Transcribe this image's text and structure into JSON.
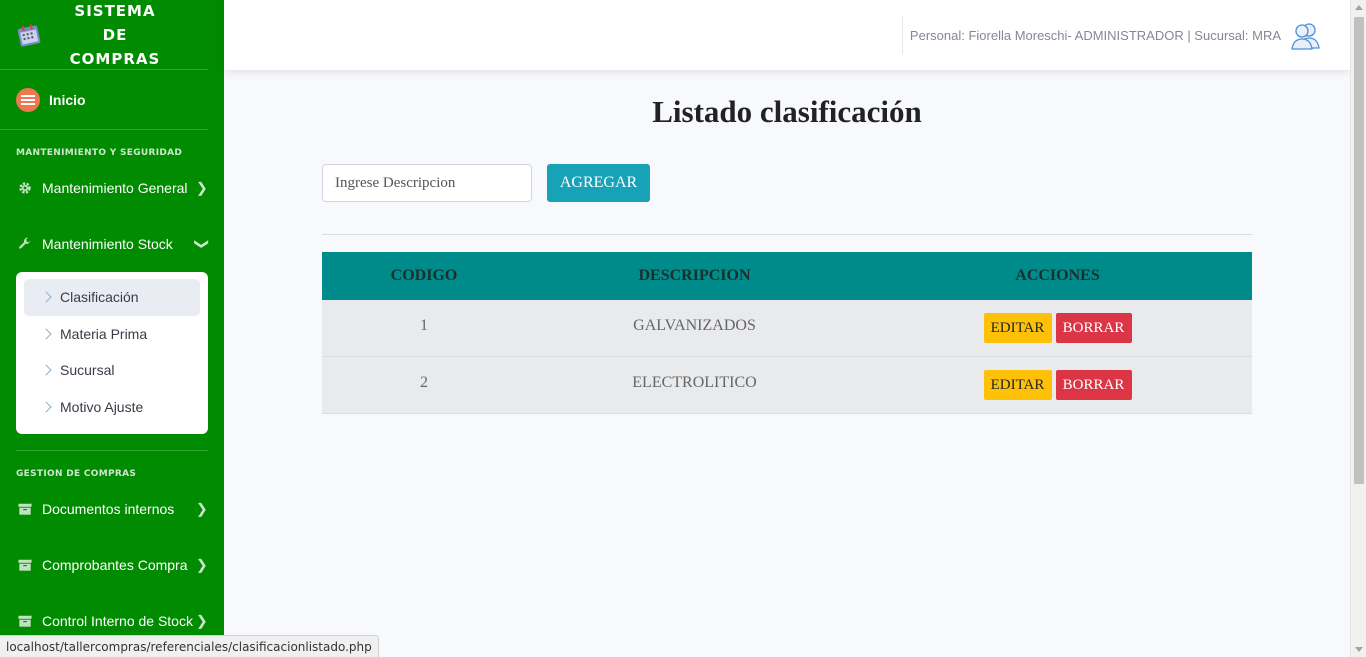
{
  "brand": {
    "title": "SISTEMA DE COMPRAS"
  },
  "nav": {
    "home_label": "Inicio",
    "section1": "MANTENIMIENTO Y SEGURIDAD",
    "mant_general": "Mantenimiento General",
    "mant_stock": "Mantenimiento Stock",
    "sub_items": [
      "Clasificación",
      "Materia Prima",
      "Sucursal",
      "Motivo Ajuste"
    ],
    "section2": "GESTION DE COMPRAS",
    "docs_internos": "Documentos internos",
    "comprobantes": "Comprobantes Compra",
    "control_stock": "Control Interno de Stock"
  },
  "topbar": {
    "user_info": "Personal: Fiorella Moreschi- ADMINISTRADOR | Sucursal: MRA"
  },
  "main": {
    "title": "Listado clasificación",
    "search_placeholder": "Ingrese Descripcion",
    "add_label": "AGREGAR",
    "columns": [
      "CODIGO",
      "DESCRIPCION",
      "ACCIONES"
    ],
    "rows": [
      {
        "codigo": "1",
        "descripcion": "GALVANIZADOS"
      },
      {
        "codigo": "2",
        "descripcion": "ELECTROLITICO"
      }
    ],
    "edit_label": "EDITAR",
    "delete_label": "BORRAR"
  },
  "status_url": "localhost/tallercompras/referenciales/clasificacionlistado.php",
  "colors": {
    "sidebar": "#008b00",
    "table_header": "#008b8b",
    "add_button": "#17a2b8",
    "edit_button": "#ffc107",
    "delete_button": "#dc3545"
  }
}
